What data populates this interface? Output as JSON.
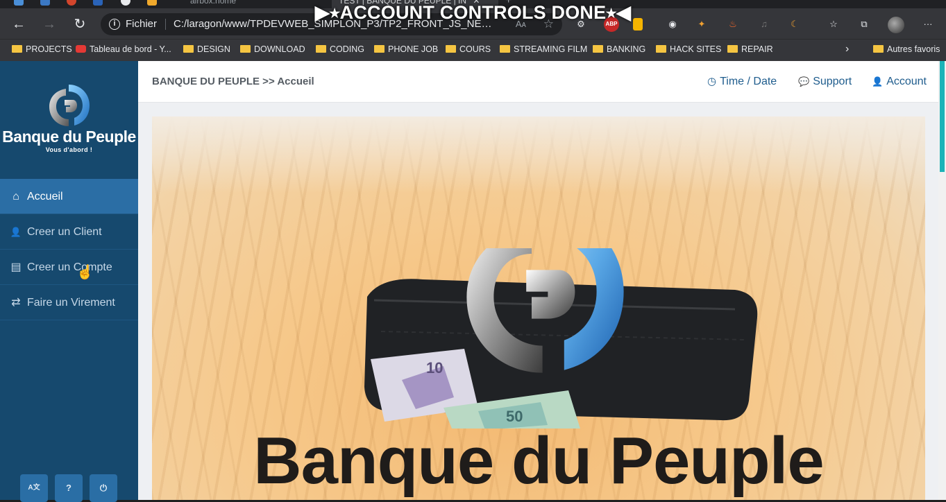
{
  "overlay": {
    "title": "▶⭑ACCOUNT CONTROLS DONE⭑◀"
  },
  "browser": {
    "tabs": [
      {
        "label": "airbox.home",
        "close": "✕"
      },
      {
        "label": "TEST | BANQUE DU PEUPLE | IN",
        "close": "✕"
      }
    ],
    "new_tab": "+",
    "back": "←",
    "forward": "→",
    "reload": "↻",
    "scheme_label": "Fichier",
    "url": "C:/laragon/www/TPDEVWEB_SIMPLON_P3/TP2_FRONT_JS_NEW/i...",
    "star": "☆",
    "read_aloud": "Aᴀ",
    "menu": "···",
    "extensions": {
      "abp": "ABP"
    },
    "bookmarks": [
      "PROJECTS",
      "Tableau de bord - Y...",
      "DESIGN",
      "DOWNLOAD",
      "CODING",
      "PHONE JOB",
      "COURS",
      "STREAMING FILM",
      "BANKING",
      "HACK SITES",
      "REPAIR"
    ],
    "bookmarks_more": "›",
    "other_bookmarks": "Autres favoris"
  },
  "sidebar": {
    "brand": "Banque du Peuple",
    "tagline": "Vous d'abord !",
    "items": [
      {
        "label": "Accueil",
        "icon": "home-icon",
        "glyph": "⌂",
        "active": true
      },
      {
        "label": "Creer un Client",
        "icon": "user-icon",
        "glyph": "👤",
        "active": false
      },
      {
        "label": "Creer un Compte",
        "icon": "id-card-icon",
        "glyph": "▤",
        "active": false
      },
      {
        "label": "Faire un Virement",
        "icon": "exchange-icon",
        "glyph": "⇄",
        "active": false
      }
    ],
    "footer": [
      {
        "icon": "language-icon",
        "glyph": "A文"
      },
      {
        "icon": "help-icon",
        "glyph": "?"
      },
      {
        "icon": "power-icon",
        "glyph": "⏻"
      }
    ]
  },
  "header": {
    "breadcrumb": "BANQUE DU PEUPLE >> Accueil",
    "links": [
      {
        "label": "Time / Date",
        "icon": "clock-icon",
        "glyph": "◷"
      },
      {
        "label": "Support",
        "icon": "comments-icon",
        "glyph": "💬"
      },
      {
        "label": "Account",
        "icon": "user-icon",
        "glyph": "👤"
      }
    ]
  },
  "hero": {
    "title": "Banque du Peuple",
    "banknote_values": [
      "10",
      "50"
    ]
  },
  "colors": {
    "sidebar_bg": "#16496e",
    "sidebar_active": "#2b6ea5",
    "accent_link": "#1e5c8d",
    "scroll_thumb": "#1cb3b8"
  }
}
